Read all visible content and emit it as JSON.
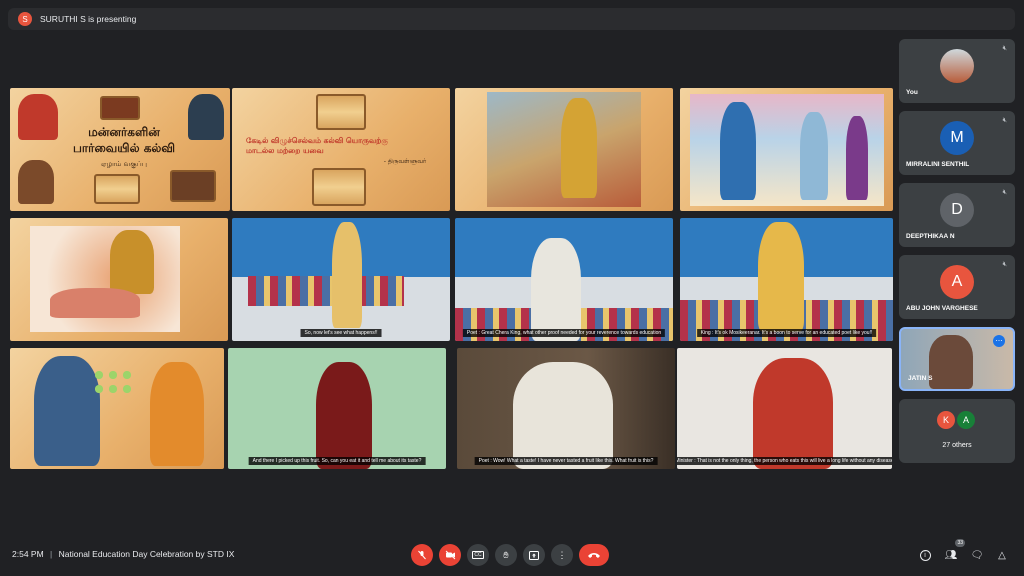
{
  "presenter": {
    "initial": "S",
    "text": "SURUTHI S is presenting"
  },
  "slides": {
    "title_main": "மன்னர்களின் பார்வையில் கல்வி",
    "title_sub": "ஏழாம் வகுப்பு",
    "verse": "கேடில் விழுச்செல்வம் கல்வி யொருவற்கு மாடல்ல மற்றை யவை",
    "verse_author": "- திருவள்ளுவர்"
  },
  "captions": {
    "c1": "So, now let's see what happens!!",
    "c2": "Poet : Great Chera King, what other proof needed for your reverence towards education",
    "c3": "King : It's ok Mosikeeranar. It's a boon to serve for an educated poet like you!!",
    "c4": "And there I picked up this fruit. So, can you eat it and tell me about its taste?",
    "c5": "Poet : Wow! What a taste! I have never tasted a fruit like this. What fruit is this?",
    "c6": "Minister : That is not the only thing, the person who eats this will live a long life without any disease"
  },
  "participants": [
    {
      "name": "You",
      "initial": "",
      "color": "#b85c3a"
    },
    {
      "name": "MIRRALINI SENTHIL",
      "initial": "M",
      "color": "#1a5fb4"
    },
    {
      "name": "DEEPTHIKAA N",
      "initial": "D",
      "color": "#5f6368"
    },
    {
      "name": "ABU JOHN VARGHESE",
      "initial": "A",
      "color": "#e8553e"
    },
    {
      "name": "JATIN S",
      "initial": "",
      "color": "#7a8fa0"
    }
  ],
  "others": {
    "initials": [
      "K",
      "A"
    ],
    "label": "27 others"
  },
  "bottom": {
    "time": "2:54 PM",
    "separator": "|",
    "meeting": "National Education Day Celebration by STD IX",
    "people_count": "33"
  },
  "colors": {
    "end_call": "#ea4335",
    "accent": "#8ab4f8"
  }
}
